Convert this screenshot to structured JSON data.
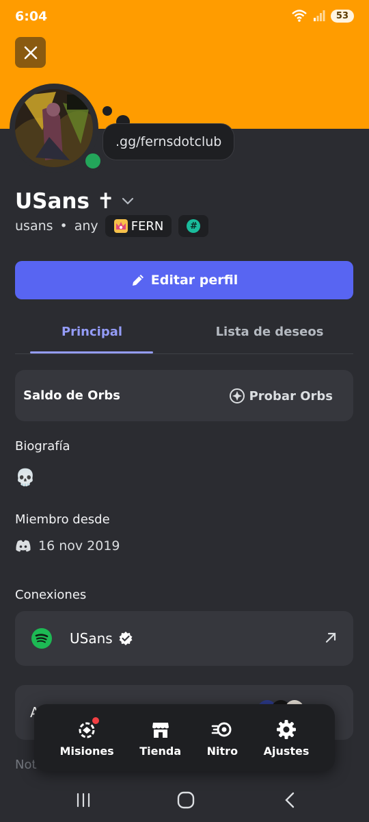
{
  "status_bar": {
    "time": "6:04",
    "battery": "53"
  },
  "profile": {
    "custom_status": ".gg/fernsdotclub",
    "display_name": "USans ✝",
    "username": "usans",
    "separator": "•",
    "pronouns": "any",
    "guild_tag": "FERN",
    "hashtag_badge": "#"
  },
  "actions": {
    "edit_profile_label": "Editar perfil"
  },
  "tabs": {
    "main": "Principal",
    "wishlist": "Lista de deseos"
  },
  "orbs": {
    "title": "Saldo de Orbs",
    "try_label": "Probar Orbs"
  },
  "bio": {
    "title": "Biografía",
    "content": "💀"
  },
  "member_since": {
    "title": "Miembro desde",
    "date": "16 nov 2019"
  },
  "connections": {
    "title": "Conexiones",
    "items": [
      {
        "service": "spotify",
        "name": "USans",
        "verified": true
      }
    ]
  },
  "bottom_nav": {
    "items": [
      {
        "label": "Misiones",
        "icon": "quests-icon",
        "has_notification": true
      },
      {
        "label": "Tienda",
        "icon": "shop-icon"
      },
      {
        "label": "Nitro",
        "icon": "nitro-icon"
      },
      {
        "label": "Ajustes",
        "icon": "settings-icon"
      }
    ]
  },
  "colors": {
    "banner": "#ff9c00",
    "background": "#2b2c31",
    "card": "#36373d",
    "accent": "#5865f2",
    "tab_active": "#949cf7",
    "online": "#23a55a",
    "spotify": "#1db954",
    "notification": "#f23f43"
  }
}
